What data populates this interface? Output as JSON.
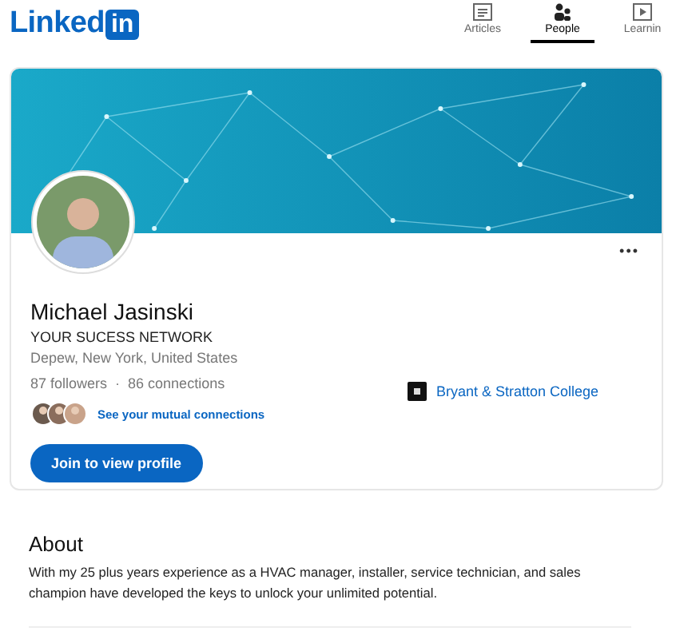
{
  "logo": {
    "text": "Linked",
    "badge": "in"
  },
  "nav": [
    {
      "label": "Articles",
      "kind": "articles",
      "selected": false
    },
    {
      "label": "People",
      "kind": "people",
      "selected": true
    },
    {
      "label": "Learnin",
      "kind": "learning",
      "selected": false
    }
  ],
  "profile": {
    "more": "•••",
    "name": "Michael Jasinski",
    "headline": "YOUR SUCESS NETWORK",
    "location": "Depew, New York, United States",
    "followers": "87 followers",
    "separator": "·",
    "connections": "86 connections",
    "mutual": "See your mutual connections",
    "join": "Join to view profile",
    "education": "Bryant & Stratton College"
  },
  "about": {
    "title": "About",
    "text": "With my 25 plus years experience as a HVAC manager, installer, service technician, and sales champion have developed the keys to unlock your unlimited potential."
  }
}
